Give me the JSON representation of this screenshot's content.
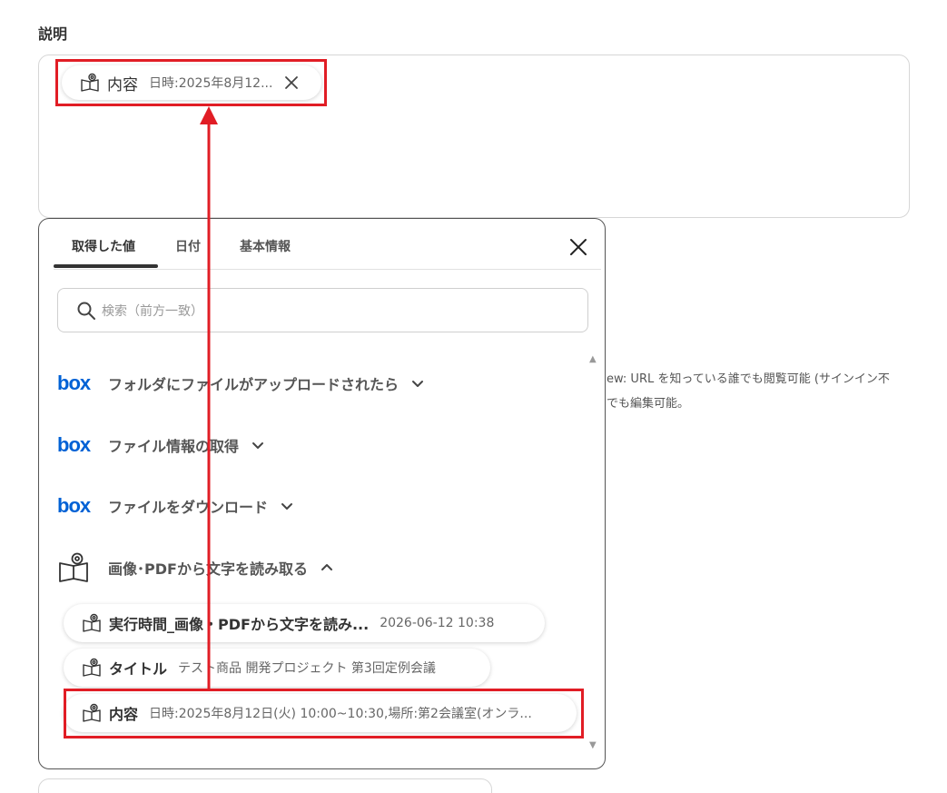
{
  "field": {
    "label": "説明"
  },
  "selected_chip": {
    "name": "内容",
    "value": "日時:2025年8月12..."
  },
  "background_text": {
    "line1": "ew: URL を知っている誰でも閲覧可能 (サインイン不",
    "line2": "でも編集可能。"
  },
  "panel": {
    "tabs": [
      {
        "label": "取得した値",
        "active": true
      },
      {
        "label": "日付",
        "active": false
      },
      {
        "label": "基本情報",
        "active": false
      }
    ],
    "search": {
      "placeholder": "検索（前方一致）"
    },
    "operations": [
      {
        "label": "フォルダにファイルがアップロードされたら",
        "icon": "box-logo",
        "expanded": false
      },
      {
        "label": "ファイル情報の取得",
        "icon": "box-logo",
        "expanded": false
      },
      {
        "label": "ファイルをダウンロード",
        "icon": "box-logo",
        "expanded": false
      },
      {
        "label": "画像･PDFから文字を読み取る",
        "icon": "ocr-book-icon",
        "expanded": true
      }
    ],
    "outputs": [
      {
        "name": "実行時間_画像・PDFから文字を読み...",
        "value": "2026-06-12 10:38"
      },
      {
        "name": "タイトル",
        "value": "テスト商品 開発プロジェクト 第3回定例会議"
      },
      {
        "name": "内容",
        "value": "日時:2025年8月12日(火) 10:00~10:30,場所:第2会議室(オンラ..."
      }
    ]
  },
  "colors": {
    "highlight": "#e11d25",
    "box_brand": "#0061d5",
    "text": "#333333"
  }
}
